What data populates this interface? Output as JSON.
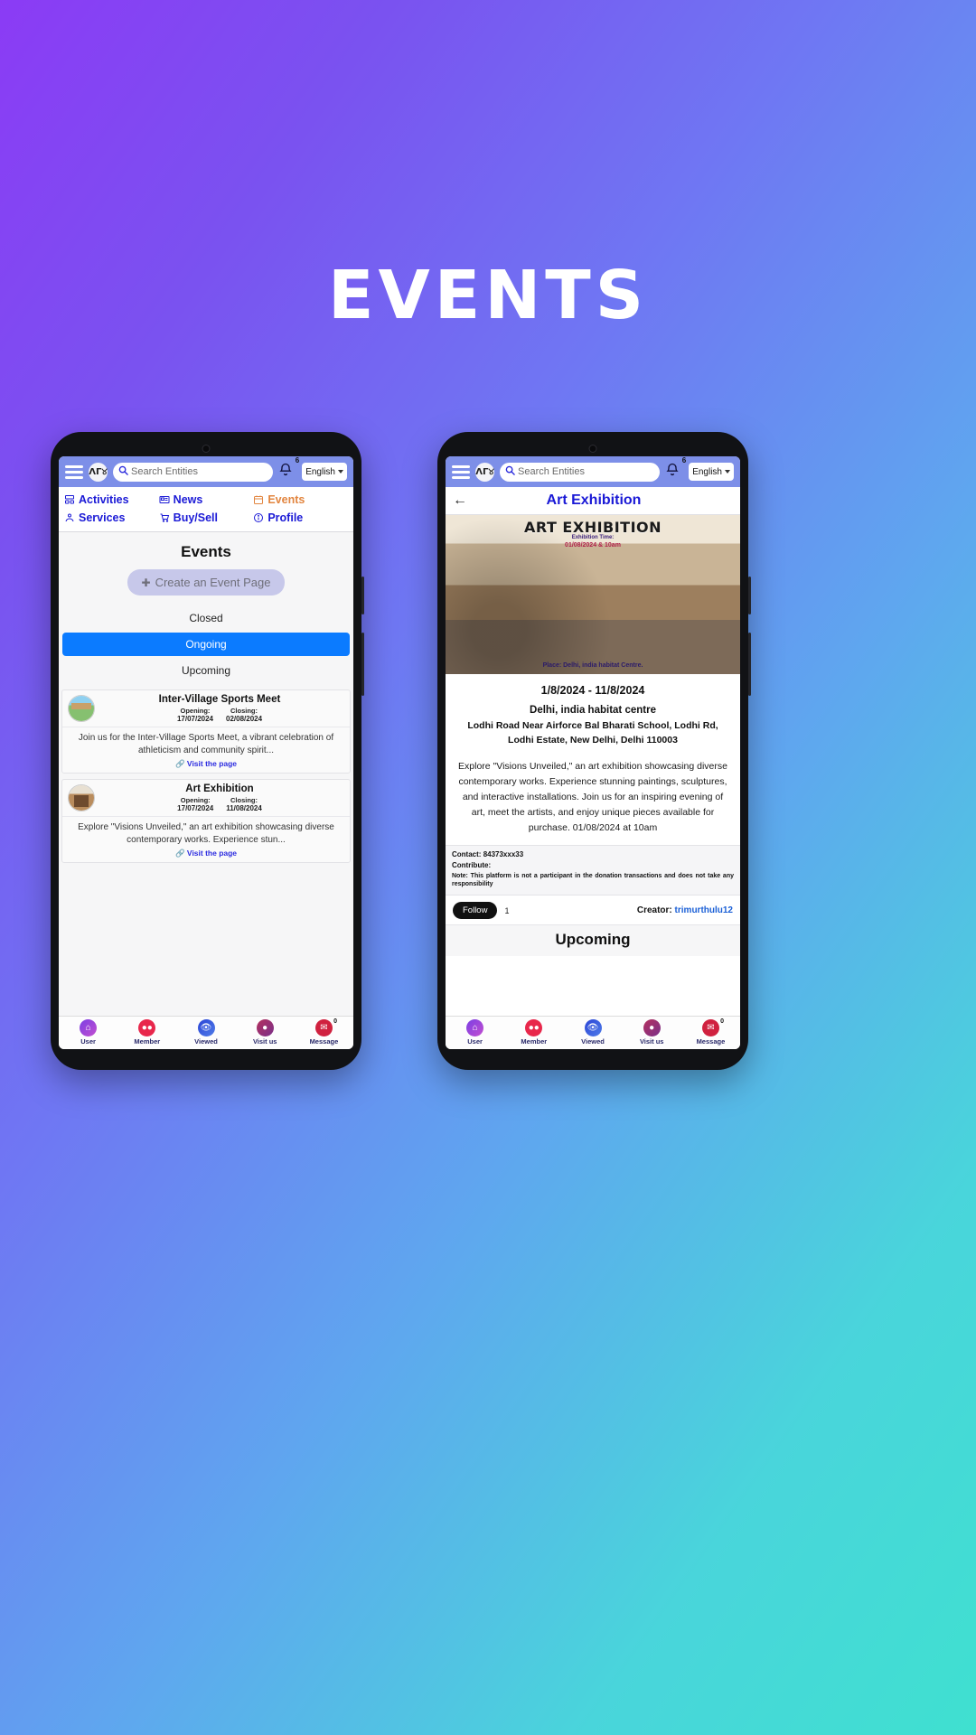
{
  "banner": {
    "title": "EVENTS"
  },
  "header": {
    "menu_icon": "hamburger-icon",
    "logo_text": "ΛΓ୪",
    "search_placeholder": "Search Entities",
    "search_value": "",
    "search_icon": "search-icon",
    "bell_icon": "bell-icon",
    "bell_badge": "6",
    "language": "English"
  },
  "nav_tabs": [
    {
      "label": "Activities",
      "icon": "dashboard-icon",
      "active": false
    },
    {
      "label": "News",
      "icon": "newspaper-icon",
      "active": false
    },
    {
      "label": "Events",
      "icon": "calendar-icon",
      "active": true
    },
    {
      "label": "Services",
      "icon": "services-icon",
      "active": false
    },
    {
      "label": "Buy/Sell",
      "icon": "cart-icon",
      "active": false
    },
    {
      "label": "Profile",
      "icon": "info-circle-icon",
      "active": false
    }
  ],
  "phone1": {
    "page_title": "Events",
    "create_button": "Create an Event Page",
    "create_icon": "plus-circle-icon",
    "filters": [
      {
        "label": "Closed",
        "selected": false
      },
      {
        "label": "Ongoing",
        "selected": true
      },
      {
        "label": "Upcoming",
        "selected": false
      }
    ],
    "filter_selected_color": "#0b7bff",
    "events": [
      {
        "name": "Inter-Village Sports Meet",
        "opening_label": "Opening:",
        "opening_date": "17/07/2024",
        "closing_label": "Closing:",
        "closing_date": "02/08/2024",
        "description": "Join us for the Inter-Village Sports Meet, a vibrant celebration of athleticism and community spirit...",
        "link_label": "Visit the page",
        "link_icon": "link-icon"
      },
      {
        "name": "Art Exhibition",
        "opening_label": "Opening:",
        "opening_date": "17/07/2024",
        "closing_label": "Closing:",
        "closing_date": "11/08/2024",
        "description": "Explore \"Visions Unveiled,\" an art exhibition showcasing diverse contemporary works. Experience stun...",
        "link_label": "Visit the page",
        "link_icon": "link-icon"
      }
    ]
  },
  "phone2": {
    "back_icon": "back-arrow-icon",
    "detail_title": "Art Exhibition",
    "hero": {
      "headline": "ART EXHIBITION",
      "sub1": "Exhibition Time:",
      "sub2": "01/08/2024 & 10am",
      "place": "Place:  Delhi, india habitat Centre."
    },
    "date_range": "1/8/2024 - 11/8/2024",
    "venue": "Delhi, india habitat centre",
    "address": "Lodhi Road Near Airforce Bal Bharati School, Lodhi Rd, Lodhi Estate, New Delhi, Delhi 110003",
    "body": "Explore \"Visions Unveiled,\" an art exhibition showcasing diverse contemporary works. Experience stunning paintings, sculptures, and interactive installations. Join us for an inspiring evening of art, meet the artists, and enjoy unique pieces available for purchase. 01/08/2024 at 10am",
    "contact_label": "Contact:",
    "contact_value": "84373xxx33",
    "contribute_label": "Contribute:",
    "contribute_value": "",
    "note_label": "Note:",
    "note_text": "This platform is not a participant in the donation transactions and does not take any responsibility",
    "follow_label": "Follow",
    "follow_count": "1",
    "creator_label": "Creator:",
    "creator_name": "trimurthulu12",
    "upcoming_heading": "Upcoming"
  },
  "bottom_bar": [
    {
      "label": "User",
      "icon": "user-home-icon",
      "color": "#6d3fd4",
      "badge": ""
    },
    {
      "label": "Member",
      "icon": "members-icon",
      "color": "#e8274b",
      "badge": ""
    },
    {
      "label": "Viewed",
      "icon": "eye-icon",
      "color": "#2b45d6",
      "badge": ""
    },
    {
      "label": "Visit us",
      "icon": "location-pin-icon",
      "color": "#b4315e",
      "badge": ""
    },
    {
      "label": "Message",
      "icon": "message-icon",
      "color": "#d0213f",
      "badge": "0"
    }
  ]
}
